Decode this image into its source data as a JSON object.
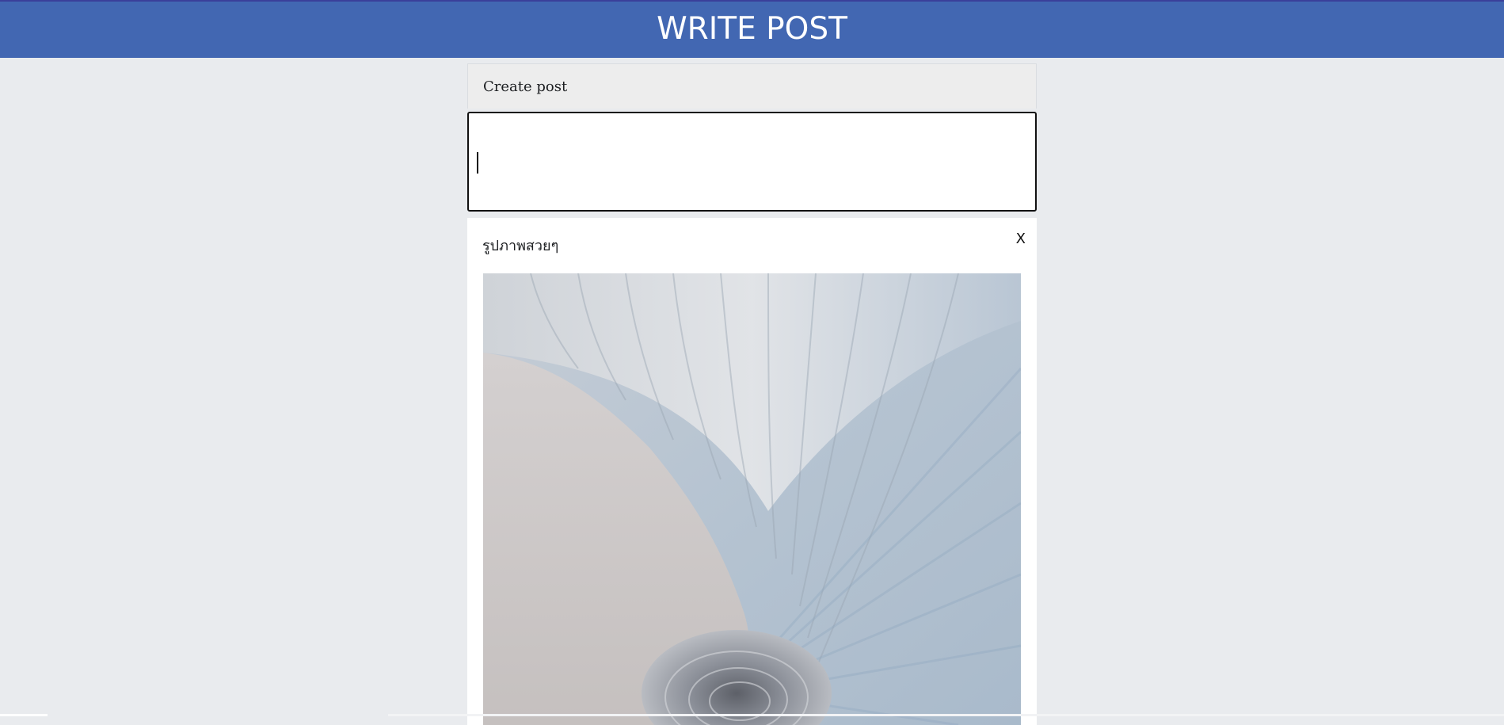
{
  "header": {
    "title": "WRITE POST"
  },
  "composer": {
    "label": "Create post",
    "value": ""
  },
  "attachment": {
    "caption": "รูปภาพสวยๆ",
    "remove_label": "X",
    "image_icon": "abstract-swirl-image"
  },
  "colors": {
    "header_bg": "#4267b2",
    "page_bg": "#e9ebee",
    "panel_bg": "#ededed"
  }
}
